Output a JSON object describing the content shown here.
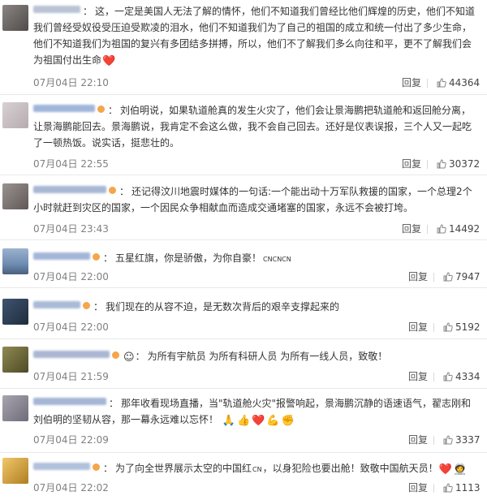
{
  "comments": [
    {
      "text": "这，一定是美国人无法了解的情怀，他们不知道我们曾经比他们辉煌的历史，他们不知道我们曾经受奴役受压迫受欺凌的泪水，他们不知道我们为了自己的祖国的成立和统一付出了多少生命，他们不知道我们为祖国的复兴有多团结多拼搏，所以，他们不了解我们多么向往和平，更不了解我们会为祖国付出生命",
      "emoji": "❤️",
      "time": "07月04日 22:10",
      "reply_label": "回复",
      "likes": "44364",
      "avatar_color": "#6d6a66",
      "name_color": "#b9c3d4"
    },
    {
      "text": "刘伯明说，如果轨道舱真的发生火灾了，他们会让景海鹏把轨道舱和返回舱分离，让景海鹏能回去。景海鹏说，我肯定不会这么做，我不会自己回去。还好是仪表误报，三个人又一起吃了一顿热饭。说实话，挺悲壮的。",
      "time": "07月04日 22:55",
      "reply_label": "回复",
      "likes": "30372",
      "avatar_color": "#c9bfc2",
      "name_color": "#9fb5da"
    },
    {
      "text": "还记得汶川地震时媒体的一句话:一个能出动十万军队救援的国家，一个总理2个小时就赶到灾区的国家，一个因民众争相献血而造成交通堵塞的国家，永远不会被打垮。",
      "time": "07月04日 23:43",
      "reply_label": "回复",
      "likes": "14492",
      "avatar_color": "#7f7a78",
      "name_color": "#a7b7d4"
    },
    {
      "text": "五星红旗，你是骄傲，为你自豪！",
      "suffix": "CNCNCN",
      "time": "07月04日 22:00",
      "reply_label": "回复",
      "likes": "7947",
      "avatar_color": "#7a95b8",
      "name_color": "#a3b6d8"
    },
    {
      "text": "我们现在的从容不迫，是无数次背后的艰辛支撑起来的",
      "time": "07月04日 22:00",
      "reply_label": "回复",
      "likes": "5192",
      "avatar_color": "#34465c",
      "name_color": "#a9bbd6"
    },
    {
      "text": "为所有宇航员 为所有科研人员 为所有一线人员，致敬！",
      "time": "07月04日 21:59",
      "reply_label": "回复",
      "likes": "4334",
      "avatar_color": "#6f6a3c",
      "name_color": "#aab7d3"
    },
    {
      "text": "那年收看现场直播，当\"轨道舱火灾\"报警响起，景海鹏沉静的语速语气，翟志刚和刘伯明的坚韧从容，那一幕永远难以忘怀！",
      "emojis": [
        "🙏",
        "👍",
        "❤️",
        "💪",
        "✊"
      ],
      "time": "07月04日 22:09",
      "reply_label": "回复",
      "likes": "3337",
      "avatar_color": "#8d8a96",
      "name_color": "#a4b5d6"
    },
    {
      "text": "为了向全世界展示太空的中国红",
      "suffix": "CN",
      "text2": "，以身犯险也要出舱！致敬中国航天员！",
      "emojis": [
        "❤️",
        "🧑‍🚀"
      ],
      "time": "07月04日 22:02",
      "reply_label": "回复",
      "likes": "1113",
      "avatar_color": "#d9a94a",
      "name_color": "#b1c0db"
    }
  ],
  "colors": {
    "badge": "#f5a54a",
    "heart": "#e8303a",
    "meta": "#808080",
    "divider": "#e9e9e9"
  }
}
